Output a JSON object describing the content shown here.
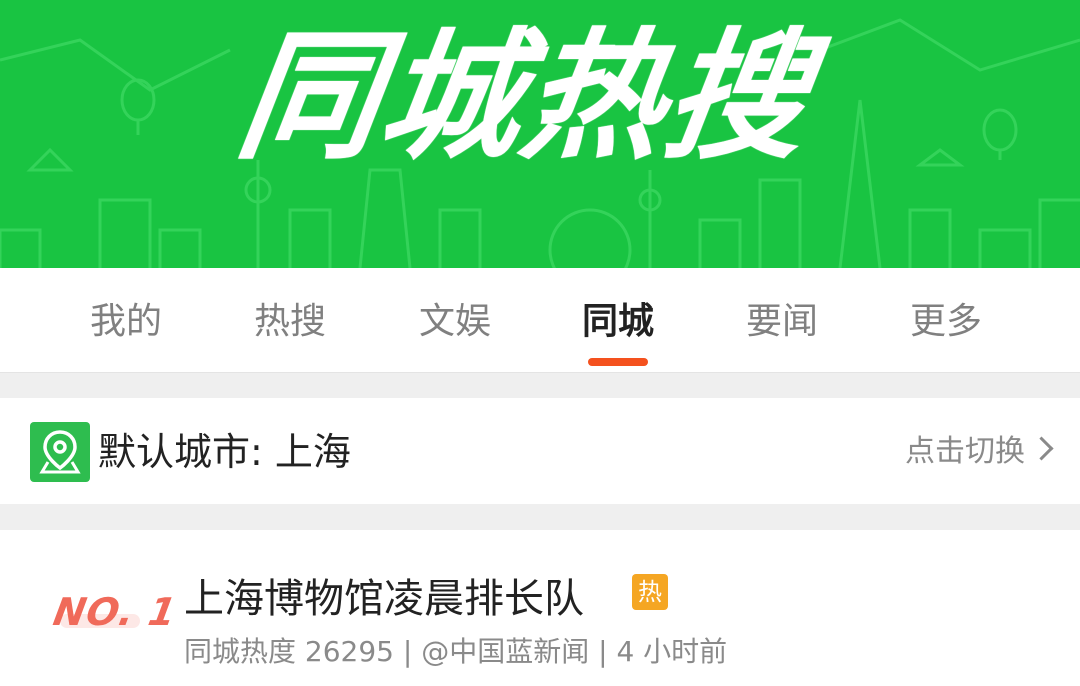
{
  "banner": {
    "title": "同城热搜"
  },
  "tabs": [
    {
      "label": "我的"
    },
    {
      "label": "热搜"
    },
    {
      "label": "文娱"
    },
    {
      "label": "同城",
      "active": true
    },
    {
      "label": "要闻"
    },
    {
      "label": "更多"
    }
  ],
  "city": {
    "icon": "location-pin-icon",
    "label": "默认城市: 上海",
    "switch_label": "点击切换"
  },
  "items": [
    {
      "rank": "NO. 1",
      "title": "上海博物馆凌晨排长队",
      "badge": "热",
      "meta": "同城热度 26295 | @中国蓝新闻 | 4 小时前"
    }
  ],
  "colors": {
    "banner_green": "#19c442",
    "accent_orange": "#f4511e",
    "badge_orange": "#f5a623",
    "rank_red": "#f06a5a"
  }
}
